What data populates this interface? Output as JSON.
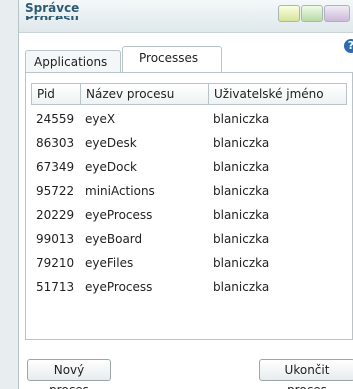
{
  "window": {
    "title": "Správce",
    "title_clipped": "Procesů"
  },
  "tabs": [
    {
      "label": "Applications"
    },
    {
      "label": "Processes"
    }
  ],
  "table": {
    "headers": [
      "Pid",
      "Název procesu",
      "Uživatelské jméno"
    ],
    "rows": [
      [
        "24559",
        "eyeX",
        "blaniczka"
      ],
      [
        "86303",
        "eyeDesk",
        "blaniczka"
      ],
      [
        "67349",
        "eyeDock",
        "blaniczka"
      ],
      [
        "95722",
        "miniActions",
        "blaniczka"
      ],
      [
        "20229",
        "eyeProcess",
        "blaniczka"
      ],
      [
        "99013",
        "eyeBoard",
        "blaniczka"
      ],
      [
        "79210",
        "eyeFiles",
        "blaniczka"
      ],
      [
        "51713",
        "eyeProcess",
        "blaniczka"
      ]
    ]
  },
  "buttons": {
    "new_process": "Nový proces",
    "end_process": "Ukončit proces"
  },
  "help": {
    "glyph": "?"
  },
  "colors": {
    "title_text": "#2d5b73",
    "help_icon": "#2b6bb0",
    "minimize": "#d6e39a",
    "maximize": "#b9d9a8",
    "close": "#cbb9d8"
  }
}
